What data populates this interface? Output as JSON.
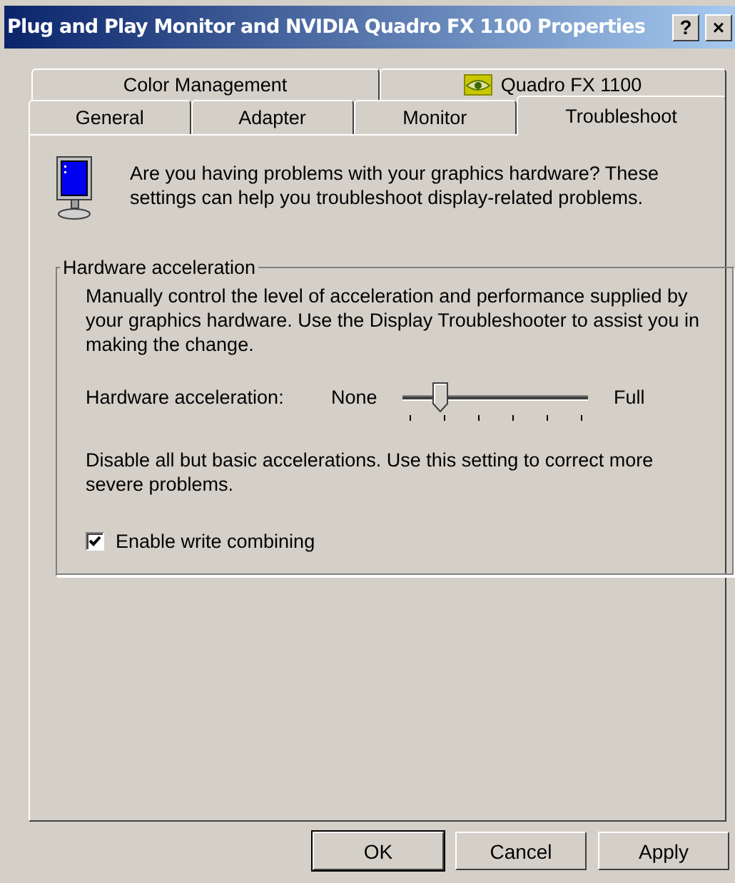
{
  "window": {
    "title": "Plug and Play Monitor and NVIDIA Quadro FX 1100 Properties",
    "help_button": "?",
    "close_button": "×"
  },
  "tab_rows": [
    [
      {
        "label": "Color Management",
        "kind": "plain",
        "selected": false
      },
      {
        "label": "Quadro FX 1100",
        "kind": "nvidia",
        "selected": false
      }
    ],
    [
      {
        "label": "General",
        "kind": "plain",
        "selected": false
      },
      {
        "label": "Adapter",
        "kind": "plain",
        "selected": false
      },
      {
        "label": "Monitor",
        "kind": "plain",
        "selected": false
      },
      {
        "label": "Troubleshoot",
        "kind": "plain",
        "selected": true
      }
    ]
  ],
  "intro": "Are you having problems with your graphics hardware? These settings can help you troubleshoot display-related problems.",
  "group": {
    "title": "Hardware acceleration",
    "description": "Manually control the level of acceleration and performance supplied by your graphics hardware. Use the Display Troubleshooter to assist you in making the change.",
    "slider": {
      "label": "Hardware acceleration:",
      "min_label": "None",
      "max_label": "Full",
      "level": 0.2
    },
    "slider_description": "Disable all but basic accelerations. Use this setting to correct more severe problems.",
    "checkbox": {
      "label": "Enable write combining",
      "checked": true
    }
  },
  "buttons": [
    {
      "label": "OK",
      "default": true
    },
    {
      "label": "Cancel",
      "default": false
    },
    {
      "label": "Apply",
      "default": false
    }
  ]
}
